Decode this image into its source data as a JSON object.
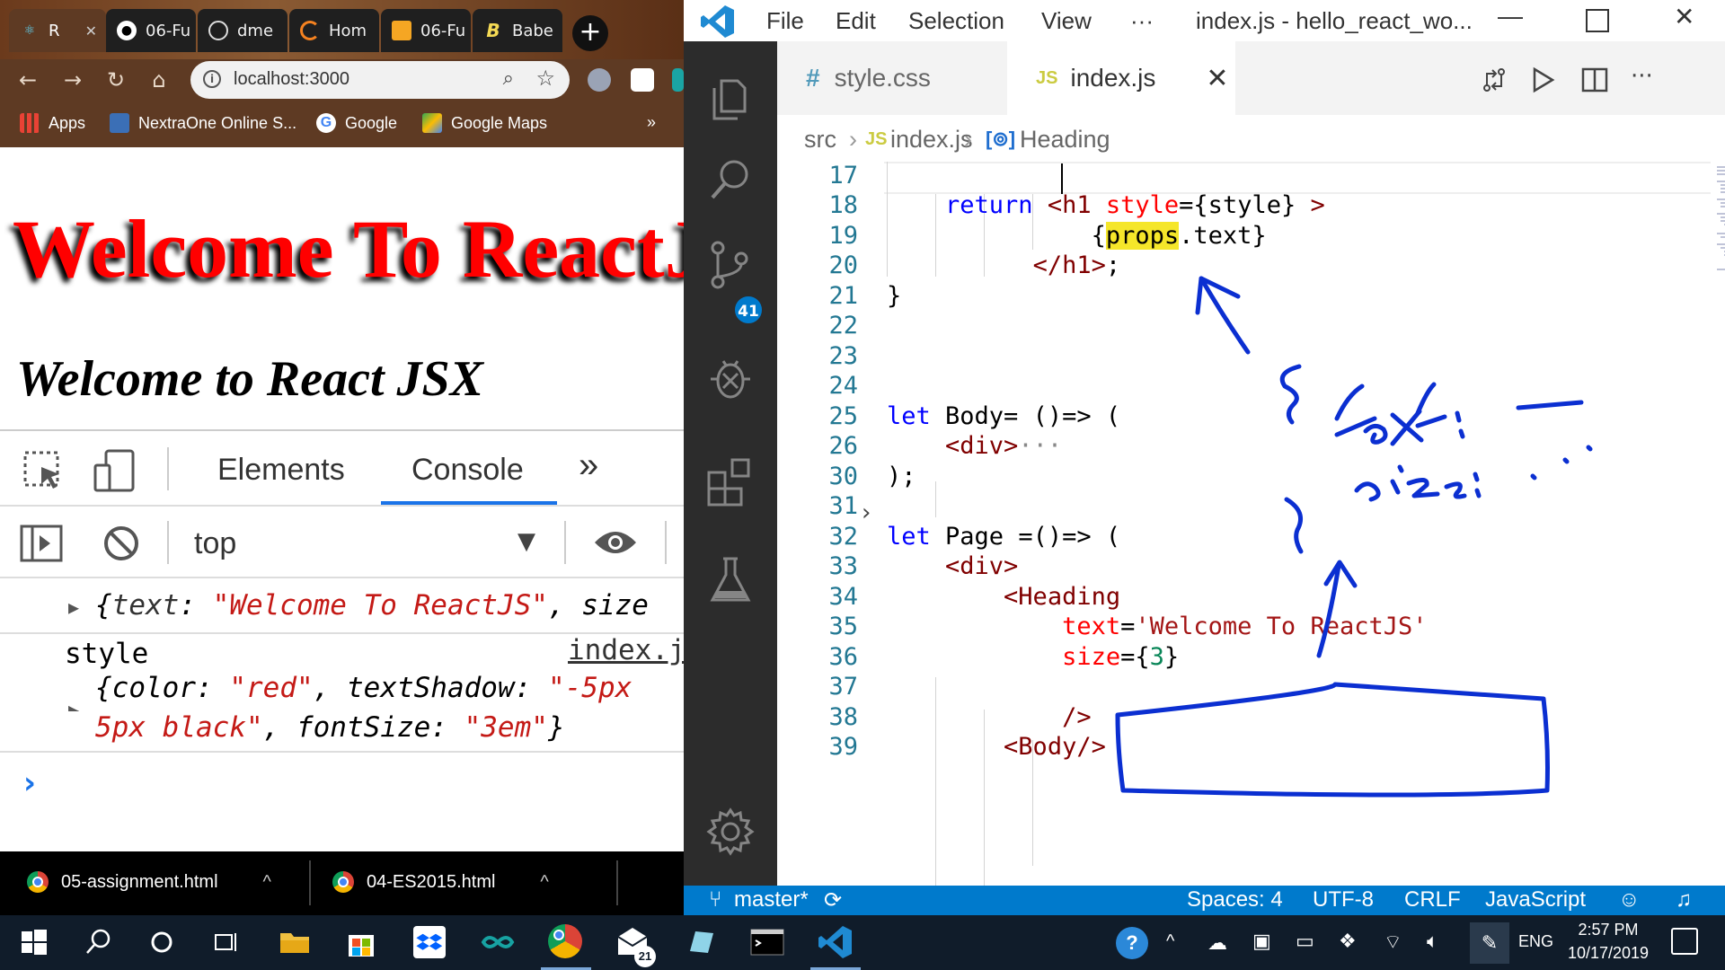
{
  "chrome": {
    "tabs": [
      {
        "label": "R",
        "icon": "react-icon"
      },
      {
        "label": "06-Fu",
        "icon": "github-icon"
      },
      {
        "label": "dme",
        "icon": "globe-icon"
      },
      {
        "label": "Hom",
        "icon": "spinner-icon"
      },
      {
        "label": "06-Fu",
        "icon": "book-icon"
      },
      {
        "label": "Babe",
        "icon": "babel-icon"
      }
    ],
    "new_tab": "+",
    "url": "localhost:3000",
    "bookmarks": [
      {
        "label": "Apps"
      },
      {
        "label": "NextraOne Online S..."
      },
      {
        "label": "Google"
      },
      {
        "label": "Google Maps"
      }
    ],
    "bookmarks_more": "»"
  },
  "page": {
    "heading": "Welcome To ReactJS",
    "subheading": "Welcome to React JSX"
  },
  "devtools": {
    "tabs": [
      "Elements",
      "Console"
    ],
    "more_tabs": "»",
    "context": "top",
    "log1": {
      "prefix": "{",
      "key1": "text",
      "val1": "\"Welcome To ReactJS\"",
      "rest": ", size"
    },
    "log2_label": "style",
    "log2_source": "index.j",
    "log3": {
      "color_key": "color",
      "color_val": "\"red\"",
      "shadow_key": "textShadow",
      "shadow_val_a": "\"-5px",
      "shadow_val_b": "5px black\"",
      "size_key": "fontSize",
      "size_val": "\"3em\""
    }
  },
  "downloads": [
    {
      "name": "05-assignment.html"
    },
    {
      "name": "04-ES2015.html"
    }
  ],
  "vscode": {
    "menu": [
      "File",
      "Edit",
      "Selection",
      "View",
      "···"
    ],
    "title": "index.js - hello_react_wo...",
    "tabs": [
      {
        "label": "style.css",
        "icon_text": "#"
      },
      {
        "label": "index.js",
        "icon_text": "JS"
      }
    ],
    "breadcrumb": [
      "src",
      "index.js",
      "Heading"
    ],
    "scm_badge": "41",
    "code_lines": [
      {
        "n": "17"
      },
      {
        "n": "18"
      },
      {
        "n": "19"
      },
      {
        "n": "20"
      },
      {
        "n": "21"
      },
      {
        "n": "22"
      },
      {
        "n": "23"
      },
      {
        "n": "24"
      },
      {
        "n": "25"
      },
      {
        "n": "26"
      },
      {
        "n": "30"
      },
      {
        "n": "31"
      },
      {
        "n": "32"
      },
      {
        "n": "33"
      },
      {
        "n": "34"
      },
      {
        "n": "35"
      },
      {
        "n": "36"
      },
      {
        "n": "37"
      },
      {
        "n": "38"
      },
      {
        "n": "39"
      }
    ],
    "status": {
      "branch": "master*",
      "spaces": "Spaces: 4",
      "encoding": "UTF-8",
      "eol": "CRLF",
      "language": "JavaScript"
    }
  },
  "taskbar": {
    "lang": "ENG",
    "time": "2:57 PM",
    "date": "10/17/2019",
    "mail_badge": "21"
  },
  "colors": {
    "accent": "#007acc",
    "activity_bar": "#2c2c2c",
    "ink": "#0b2fd1",
    "heading_red": "#ff0000"
  }
}
